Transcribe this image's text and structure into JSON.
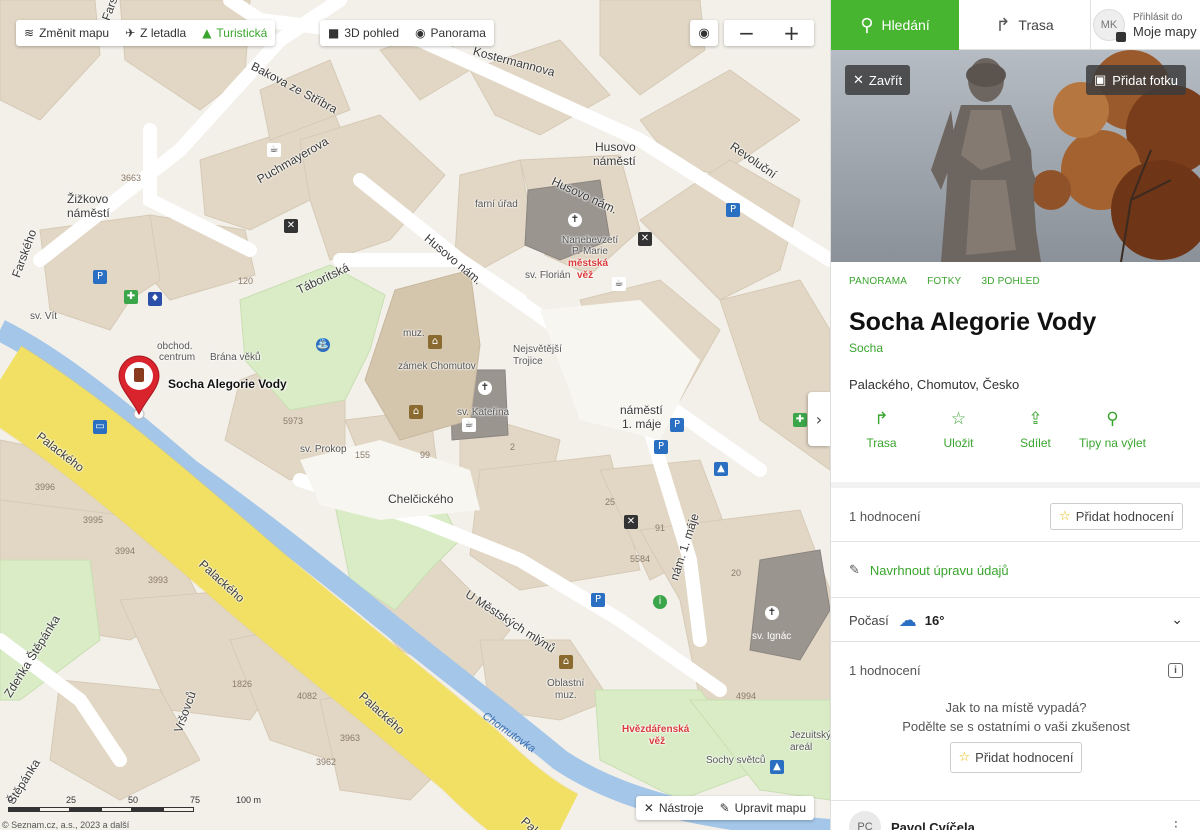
{
  "map": {
    "toolbar": {
      "change_map": "Změnit mapu",
      "aerial": "Z letadla",
      "tourist": "Turistická",
      "view3d": "3D pohled",
      "panorama": "Panorama"
    },
    "zoom": {
      "locate_icon": "target-icon",
      "minus": "−",
      "plus": "+"
    },
    "tools": {
      "tools_label": "Nástroje",
      "edit_label": "Upravit mapu"
    },
    "scale": {
      "t0": "0",
      "t1": "25",
      "t2": "50",
      "t3": "75",
      "unit": "100 m"
    },
    "copyright": {
      "text": "© Seznam.cz, a.s., 2023 a",
      "link": "další"
    },
    "marker_label": "Socha Alegorie Vody",
    "labels": {
      "farskeho_top": "Farského",
      "farskeho_left": "Farského",
      "zizkovo": "Žižkovo",
      "namesti": "náměstí",
      "puchmayerova": "Puchmayerova",
      "bakova": "Bakova ze Stříbra",
      "kostermannova": "Kostermannova",
      "revolucni": "Revoluční",
      "husovo_namesti": "Husovo",
      "husovo_namesti2": "náměstí",
      "husovo_nam": "Husovo nám.",
      "husovo_nam2": "Husovo nám.",
      "taboritska": "Táboritská",
      "farni_urad": "farní úřad",
      "nanebevzeti": "Nanebevzetí",
      "p_marie": "P. Marie",
      "mestska": "městská",
      "vez": "věž",
      "sv_florian": "sv. Florián",
      "sv_vit": "sv. Vít",
      "obchod": "obchod.",
      "centrum": "centrum",
      "brana": "Brána věků",
      "muz": "muz.",
      "zamek": "zámek Chomutov",
      "nejsvetejsi": "Nejsvětější",
      "trojice": "Trojice",
      "sv_katerina": "sv. Kateřina",
      "sv_prokop": "sv. Prokop",
      "namesti_1": "náměstí",
      "namesti_1b": "1. máje",
      "chelcickeho": "Chelčického",
      "palackeho1": "Palackého",
      "palackeho2": "Palackého",
      "palackeho3": "Palackého",
      "palackeho4": "Palackého",
      "nam_1_maje": "nám. 1. máje",
      "u_mestskych": "U Městských mlýnů",
      "sv_ignac": "sv. Ignác",
      "oblastni": "Oblastní",
      "muz2": "muz.",
      "hvezdarenska": "Hvězdářenská",
      "vez2": "věž",
      "sochy_svetcu": "Sochy světců",
      "jezuitsky": "Jezuitský",
      "areal": "areál",
      "chomutovka": "Chomutovka",
      "vrsovcu": "Vršovců",
      "zdenka": "Zdeňka Štěpánka",
      "stepanka": "Štěpánka",
      "n3663": "3663",
      "n120": "120",
      "n3996": "3996",
      "n3995": "3995",
      "n3994": "3994",
      "n3993": "3993",
      "n5973": "5973",
      "n155": "155",
      "n99": "99",
      "n2": "2",
      "n25": "25",
      "n91": "91",
      "n5584": "5584",
      "n20": "20",
      "n4994": "4994",
      "n1826": "1826",
      "n4082": "4082",
      "n3963": "3963",
      "n3962": "3962"
    }
  },
  "panel": {
    "tabs": {
      "search": "Hledání",
      "route": "Trasa"
    },
    "account": {
      "initials": "MK",
      "line1": "Přihlásit do",
      "line2": "Moje mapy"
    },
    "photo": {
      "close": "Zavřít",
      "add_photo": "Přidat fotku"
    },
    "media_tabs": [
      "PANORAMA",
      "FOTKY",
      "3D POHLED"
    ],
    "title": "Socha Alegorie Vody",
    "type": "Socha",
    "address": "Palackého, Chomutov, Česko",
    "actions": [
      {
        "label": "Trasa",
        "icon": "route-icon"
      },
      {
        "label": "Uložit",
        "icon": "star-icon"
      },
      {
        "label": "Sdílet",
        "icon": "share-icon"
      },
      {
        "label": "Tipy na výlet",
        "icon": "trip-tips-icon"
      }
    ],
    "ratings_count": "1 hodnocení",
    "add_rating": "Přidat hodnocení",
    "suggest_edit": "Navrhnout úpravu údajů",
    "weather": {
      "label": "Počasí",
      "temp": "16°"
    },
    "reviews_count": "1 hodnocení",
    "prompt_line1": "Jak to na místě vypadá?",
    "prompt_line2": "Podělte se s ostatními o vaši zkušenost",
    "prompt_button": "Přidat hodnocení",
    "reviewer": {
      "initials": "PC",
      "name": "Pavol Cvíčela"
    }
  }
}
